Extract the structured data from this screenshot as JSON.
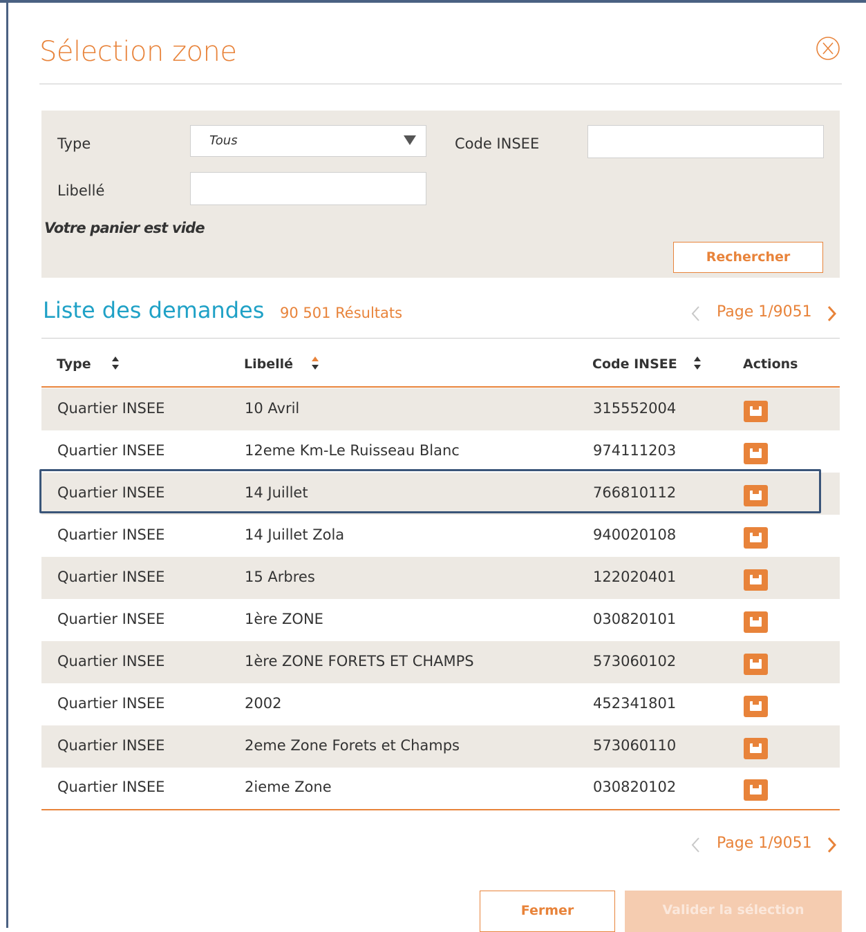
{
  "modal": {
    "title": "Sélection zone"
  },
  "filters": {
    "type_label": "Type",
    "type_value": "Tous",
    "code_label": "Code INSEE",
    "code_value": "",
    "libelle_label": "Libellé",
    "libelle_value": "",
    "cart_message": "Votre panier est vide",
    "search_label": "Rechercher"
  },
  "list": {
    "title": "Liste des demandes",
    "result_count": "90 501 Résultats",
    "page_label": "Page 1/9051",
    "columns": {
      "type": "Type",
      "libelle": "Libellé",
      "code": "Code INSEE",
      "actions": "Actions"
    },
    "rows": [
      {
        "type": "Quartier INSEE",
        "libelle": "10 Avril",
        "code": "315552004"
      },
      {
        "type": "Quartier INSEE",
        "libelle": "12eme Km-Le Ruisseau Blanc",
        "code": "974111203"
      },
      {
        "type": "Quartier INSEE",
        "libelle": "14 Juillet",
        "code": "766810112"
      },
      {
        "type": "Quartier INSEE",
        "libelle": "14 Juillet Zola",
        "code": "940020108"
      },
      {
        "type": "Quartier INSEE",
        "libelle": "15 Arbres",
        "code": "122020401"
      },
      {
        "type": "Quartier INSEE",
        "libelle": "1ère ZONE",
        "code": "030820101"
      },
      {
        "type": "Quartier INSEE",
        "libelle": "1ère ZONE FORETS ET CHAMPS",
        "code": "573060102"
      },
      {
        "type": "Quartier INSEE",
        "libelle": "2002",
        "code": "452341801"
      },
      {
        "type": "Quartier INSEE",
        "libelle": "2eme Zone Forets et Champs",
        "code": "573060110"
      },
      {
        "type": "Quartier INSEE",
        "libelle": "2ieme Zone",
        "code": "030820102"
      }
    ]
  },
  "footer": {
    "close_label": "Fermer",
    "validate_label": "Valider la sélection"
  },
  "colors": {
    "accent": "#e8833a",
    "title_blue": "#1fa1c6",
    "panel_bg": "#ede9e3",
    "highlight_border": "#3a5579"
  },
  "icons": {
    "close": "circle-x-icon",
    "select": "caret-down-icon",
    "pager_prev": "chevron-left-icon",
    "pager_next": "chevron-right-icon",
    "sort": "sort-icon",
    "row_action": "save-icon"
  }
}
